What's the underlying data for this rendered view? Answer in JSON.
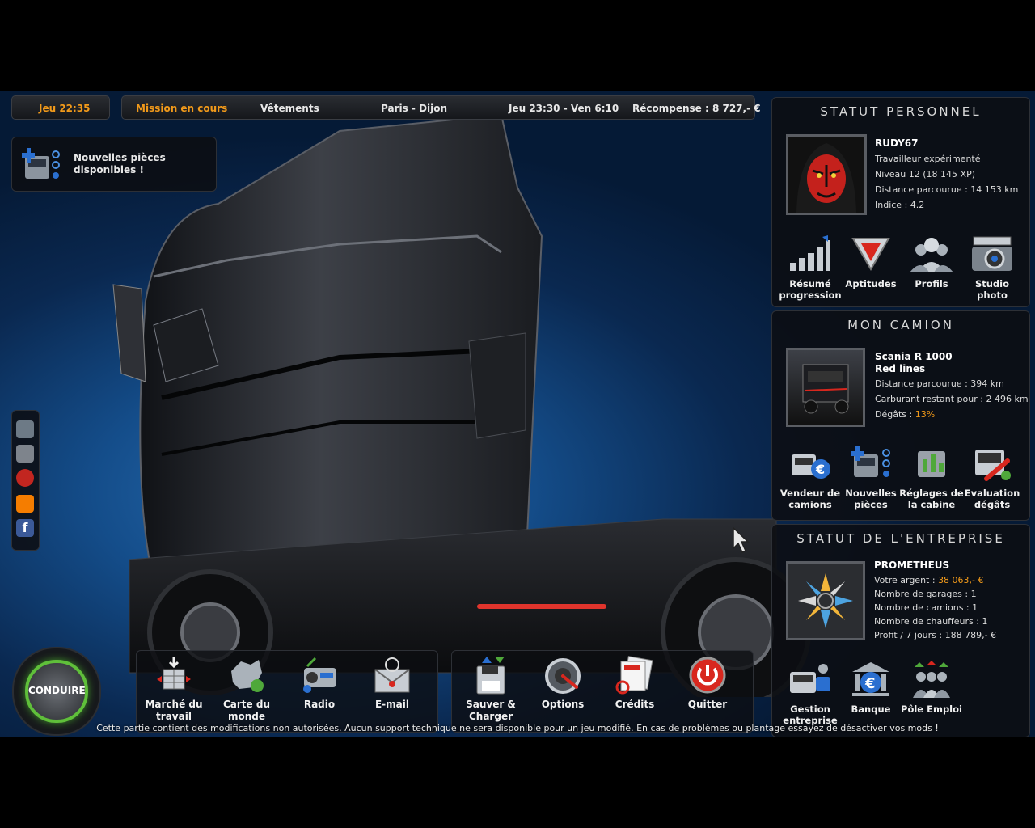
{
  "topbar": {
    "time": "Jeu 22:35",
    "mission_label": "Mission en cours",
    "cargo": "Vêtements",
    "route": "Paris - Dijon",
    "window": "Jeu 23:30 - Ven 6:10",
    "reward": "Récompense : 8 727,- €"
  },
  "notification": {
    "text": "Nouvelles pièces disponibles !"
  },
  "personal": {
    "title": "STATUT PERSONNEL",
    "name": "RUDY67",
    "rank": "Travailleur expérimenté",
    "level": "Niveau 12 (18 145 XP)",
    "distance": "Distance parcourue : 14 153 km",
    "index": "Indice : 4.2",
    "buttons": [
      {
        "label": "Résumé progression",
        "icon": "progress-bars-icon"
      },
      {
        "label": "Aptitudes",
        "icon": "skills-emblem-icon"
      },
      {
        "label": "Profils",
        "icon": "profiles-people-icon"
      },
      {
        "label": "Studio photo",
        "icon": "camera-icon"
      }
    ]
  },
  "truck": {
    "title": "MON CAMION",
    "model": "Scania R 1000",
    "name": "Red lines",
    "distance": "Distance parcourue : 394 km",
    "fuel": "Carburant restant pour : 2 496 km",
    "damage_label": "Dégâts : ",
    "damage_value": "13%",
    "buttons": [
      {
        "label": "Vendeur de camions",
        "icon": "truck-dealer-icon"
      },
      {
        "label": "Nouvelles pièces",
        "icon": "new-parts-icon"
      },
      {
        "label": "Réglages de la cabine",
        "icon": "cabin-settings-icon"
      },
      {
        "label": "Evaluation dégâts",
        "icon": "damage-wrench-icon"
      }
    ]
  },
  "company": {
    "title": "STATUT DE L'ENTREPRISE",
    "name": "PROMETHEUS",
    "money_label": "Votre argent : ",
    "money_value": "38 063,- €",
    "garages": "Nombre de garages : 1",
    "trucks": "Nombre de camions : 1",
    "drivers": "Nombre de chauffeurs : 1",
    "profit": "Profit / 7 jours : 188 789,- €",
    "buttons": [
      {
        "label": "Gestion entreprise",
        "icon": "company-management-icon"
      },
      {
        "label": "Banque",
        "icon": "bank-euro-icon"
      },
      {
        "label": "Pôle Emploi",
        "icon": "job-center-icon"
      }
    ]
  },
  "drive_button": "CONDUIRE",
  "bottom_menu": [
    {
      "label": "Marché du travail",
      "icon": "job-market-icon"
    },
    {
      "label": "Carte du monde",
      "icon": "world-map-icon"
    },
    {
      "label": "Radio",
      "icon": "radio-icon"
    },
    {
      "label": "E-mail",
      "icon": "email-icon"
    },
    {
      "label": "Sauver & Charger",
      "icon": "save-load-icon"
    },
    {
      "label": "Options",
      "icon": "options-gauge-icon"
    },
    {
      "label": "Crédits",
      "icon": "credits-icon"
    },
    {
      "label": "Quitter",
      "icon": "power-icon"
    }
  ],
  "side_icons": [
    "truck-side-icon",
    "truck-side-2-icon",
    "target-icon",
    "blogger-icon",
    "facebook-icon"
  ],
  "warning": "Cette partie contient des modifications non autorisées. Aucun support technique ne sera disponible pour un jeu modifié. En cas de problèmes ou plantage essayez de désactiver vos mods !",
  "colors": {
    "accent": "#f29a1a",
    "drive_ring": "#5fbf3a",
    "quit_red": "#d8271e"
  }
}
